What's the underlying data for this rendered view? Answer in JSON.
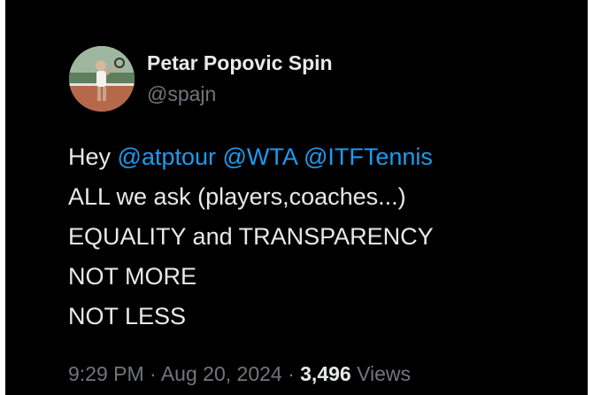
{
  "author": {
    "display_name": "Petar Popovic Spin",
    "handle": "@spajn"
  },
  "tweet": {
    "greeting": "Hey",
    "mentions": [
      "@atptour",
      "@WTA",
      "@ITFTennis"
    ],
    "lines": [
      "ALL we ask (players,coaches...)",
      "EQUALITY and TRANSPARENCY",
      "NOT MORE",
      "NOT LESS"
    ]
  },
  "meta": {
    "time": "9:29 PM",
    "date": "Aug 20, 2024",
    "separator": "·",
    "views_count": "3,496",
    "views_label": "Views"
  },
  "colors": {
    "background": "#000000",
    "text": "#e7e9ea",
    "muted": "#71767b",
    "link": "#1d9bf0"
  }
}
